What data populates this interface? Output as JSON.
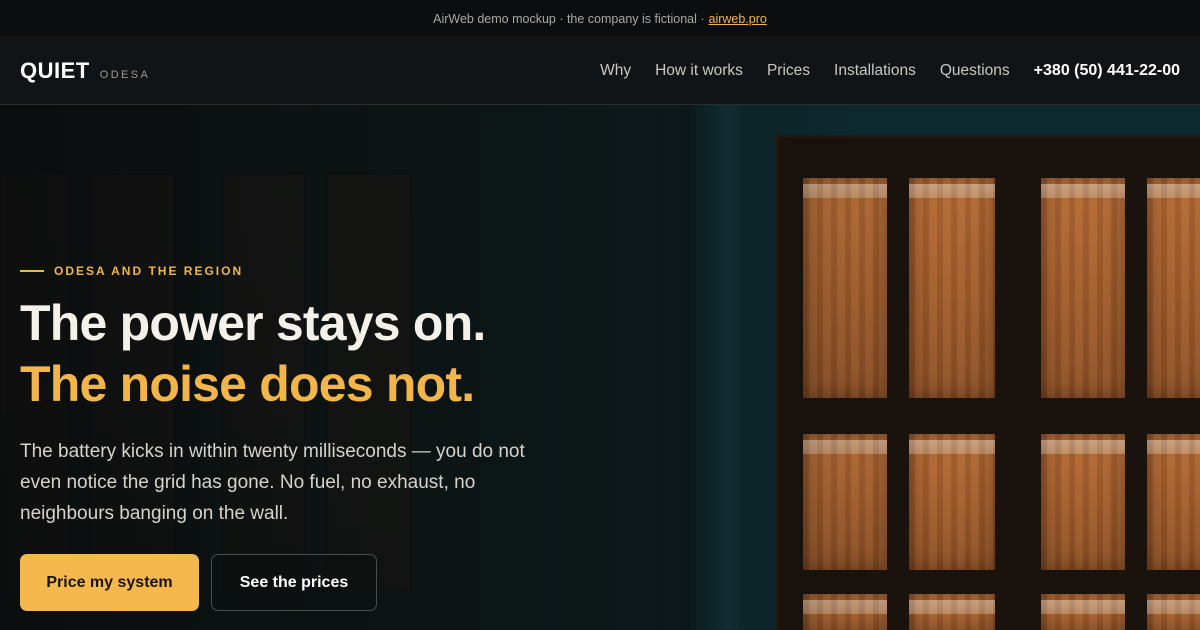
{
  "banner": {
    "text": "AirWeb demo mockup · the company is fictional ·",
    "link_label": "airweb.pro"
  },
  "nav": {
    "brand_name": "QUIET",
    "brand_sub": "ODESA",
    "links": [
      "Why",
      "How it works",
      "Prices",
      "Installations",
      "Questions"
    ],
    "phone": "+380 (50) 441-22-00"
  },
  "hero": {
    "eyebrow": "ODESA AND THE REGION",
    "headline_line1": "The power stays on.",
    "headline_line2": "The noise does not.",
    "lead": "The battery kicks in within twenty milliseconds — you do not even notice the grid has gone. No fuel, no exhaust, no neighbours banging on the wall.",
    "primary_cta": "Price my system",
    "secondary_cta": "See the prices"
  },
  "colors": {
    "accent": "#f1b549",
    "background": "#0c0f10",
    "nav_background": "#111416"
  }
}
